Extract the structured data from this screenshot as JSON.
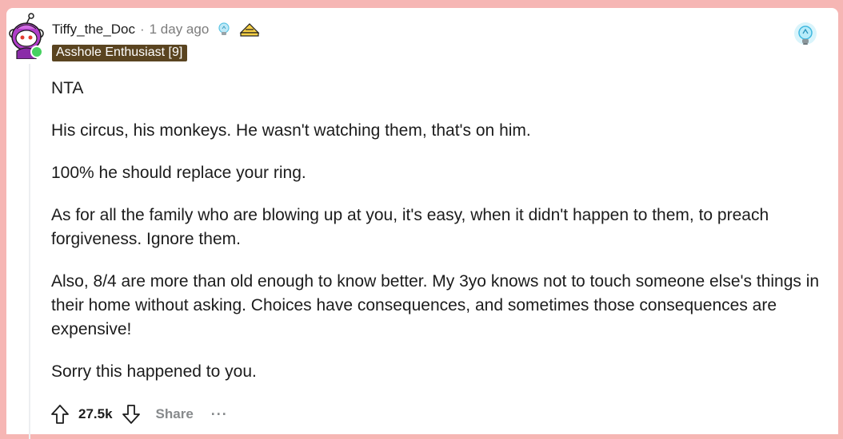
{
  "comment": {
    "author": "Tiffy_the_Doc",
    "separator": "·",
    "timestamp": "1 day ago",
    "flair": "Asshole Enthusiast [9]",
    "awards": [
      "lightbulb-award-icon",
      "hat-award-icon"
    ],
    "top_award": "glowing-lightbulb-award-icon",
    "paragraphs": [
      "NTA",
      "His circus, his monkeys. He wasn't watching them, that's on him.",
      "100% he should replace your ring.",
      "As for all the family who are blowing up at you, it's easy, when it didn't happen to them, to preach forgiveness. Ignore them.",
      "Also, 8/4 are more than old enough to know better. My 3yo knows not to touch someone else's things in their home without asking. Choices have consequences, and sometimes those consequences are expensive!",
      "Sorry this happened to you."
    ]
  },
  "actions": {
    "score": "27.5k",
    "share_label": "Share",
    "more_label": "···"
  },
  "colors": {
    "background": "#f6b6b4",
    "flair_bg": "#5a4420",
    "online": "#46d160",
    "muted": "#7c7c7c"
  }
}
